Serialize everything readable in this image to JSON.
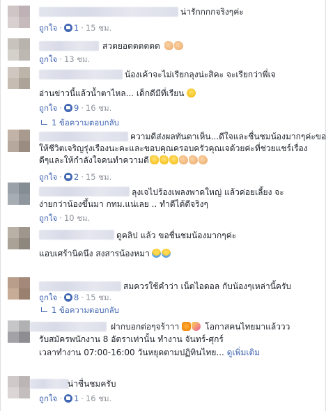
{
  "labels": {
    "like": "ถูกใจ",
    "reply": "ตอบกลับ"
  },
  "comments": [
    {
      "text": [
        "น่ารักกกกจริงๆค่ะ"
      ],
      "likes": "1",
      "time": "15 ชม."
    },
    {
      "text": [
        "สวดยอดดดดดด"
      ],
      "likes": "",
      "time": "13 ชม."
    },
    {
      "text": [
        "น้องเค้าจะไม่เรียกลุงน่ะสิคะ จะเรียกว่าพี่เจ",
        "อ่านข่าวนี้แล้วน้ำตาไหล... เด็กดีมีที่เรียน"
      ],
      "likes": "9",
      "time": "16 ชม."
    },
    {
      "text": [
        "ความดีส่งผลทันตาเห็น...ดีใจและชื่นชมน้องมากๆค่ะขอ",
        "ให้ชีวิตเจริญรุ่งเรืองนะคะและขอบคุณครอบครัวคุณเจด้วยค่ะที่ช่วยแชร์เรื่อง",
        "ดีๆและให้กำลังใจคนทำความดี"
      ],
      "likes": "2",
      "time": "15 ชม."
    },
    {
      "text": [
        "ลุงเจไปร้องเพลงพาดใหญ่ แล้วค่อยเลี้ยง จะ",
        "ง่ายกว่าน้องขึ้นมา กทม.แน่เลย .. ทำดีได้ดีจริงๆ"
      ],
      "likes": "",
      "time": "10 ชม."
    },
    {
      "text": [
        "ดูคลิป แล้ว ขอชื่นชมน้องมากๆค่ะ",
        "แอบเศร้านิดนึง สงสารน้องหมา"
      ],
      "likes": "",
      "time": "15 ชม."
    },
    {
      "text": [
        "สมควรใช้คำว่า เน็ตไอดอล กับน้องๆเหล่านี้ครับ"
      ],
      "likes": "8",
      "time": "15 ชม."
    },
    {
      "text": [
        "ฝากบอกต่อๆจร้าาา",
        "โอกาสคนไทยมาแล้ววว",
        "รับสมัครพนักงาน 8 อัตราเท่านั้น ทำงาน จันทร์-ศุกร์",
        "เวลาทำงาน 07:00-16:00 วันหยุดตามปฏิทินไทย...",
        "ดูเพิ่มเติม"
      ],
      "likes": "",
      "time": ""
    },
    {
      "text": [
        "น่าชื่นชมครับ"
      ],
      "likes": "1",
      "time": "16 ชม."
    }
  ],
  "replies": [
    {
      "label": "1 ข้อความตอบกลับ"
    },
    {
      "label": "1 ข้อความตอบกลับ"
    }
  ],
  "colors": {
    "link": "#4267b2",
    "meta": "#90949c",
    "text": "#1d2129"
  }
}
